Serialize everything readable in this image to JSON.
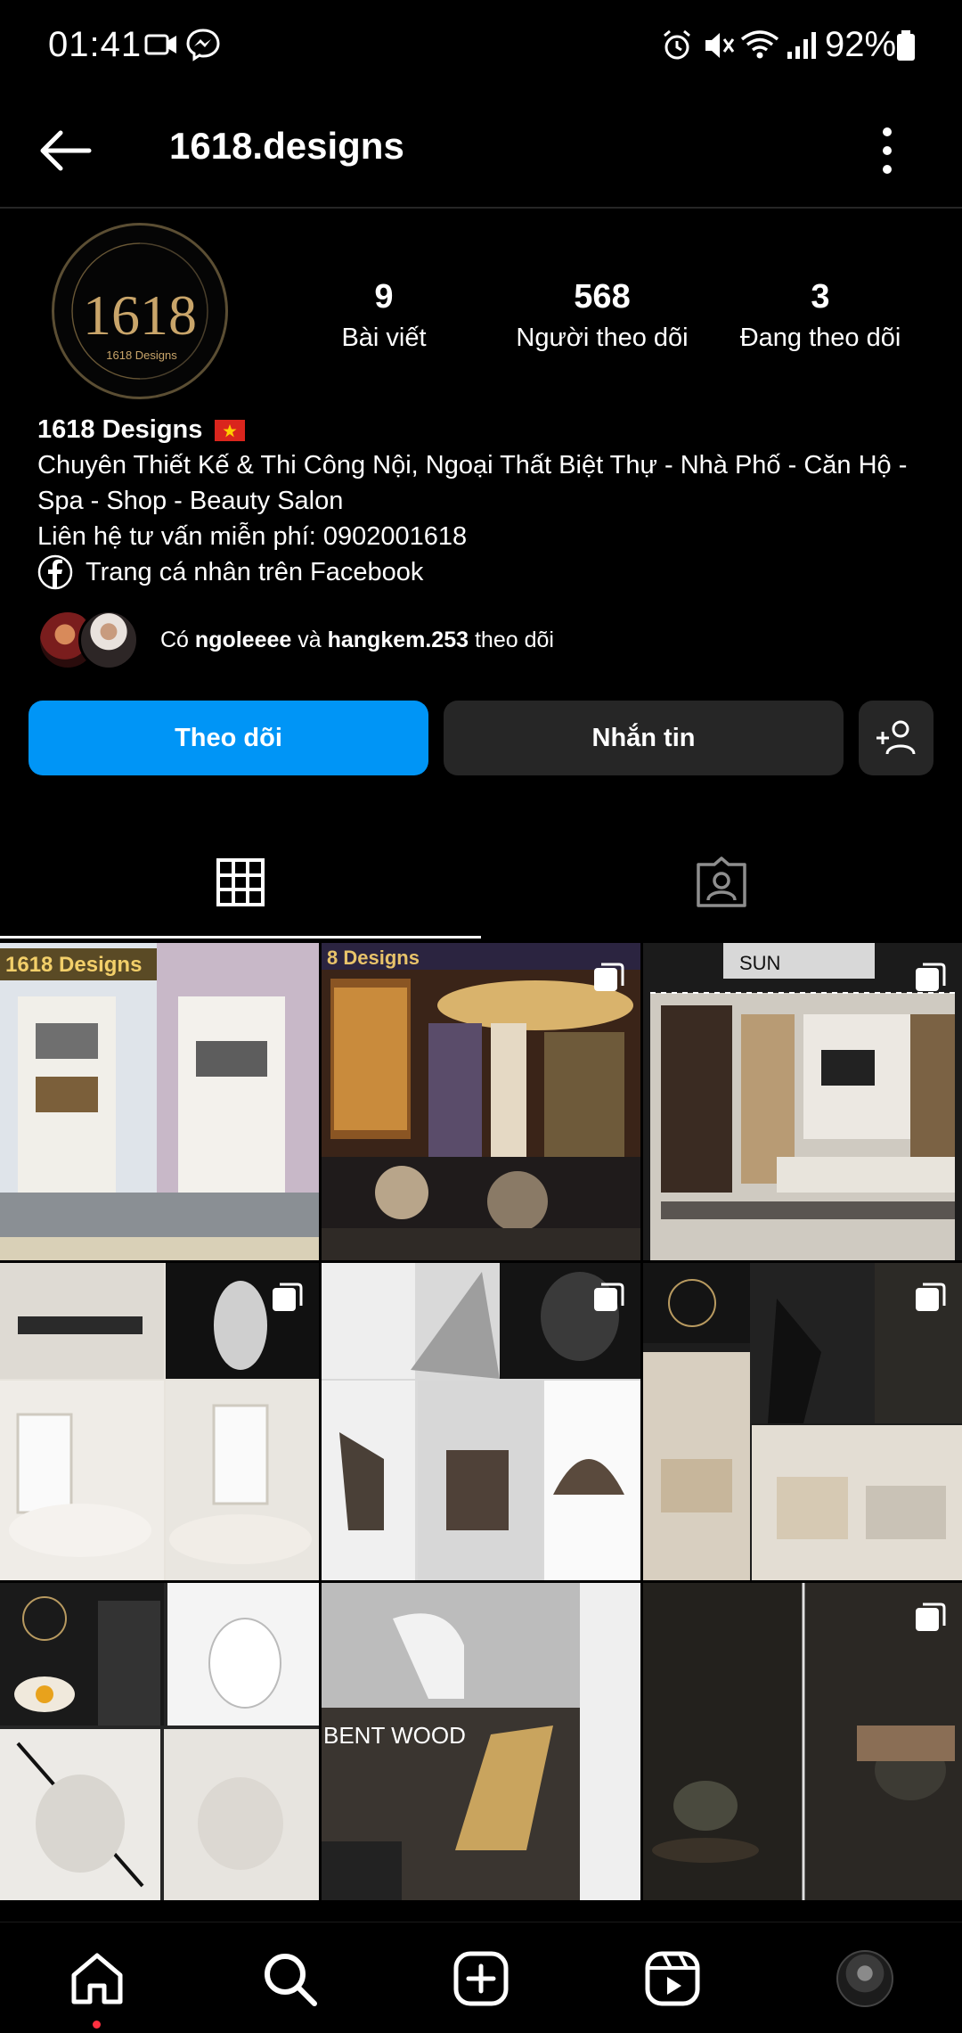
{
  "status_bar": {
    "time": "01:41",
    "battery": "92%",
    "icons": [
      "video-call-icon",
      "messenger-icon",
      "alarm-icon",
      "vibrate-icon",
      "wifi-icon",
      "signal-icon",
      "battery-icon"
    ]
  },
  "header": {
    "username": "1618.designs"
  },
  "profile": {
    "avatar_text_top": "1618",
    "avatar_text_bottom": "1618 Designs",
    "stats": [
      {
        "value": "9",
        "label": "Bài viết"
      },
      {
        "value": "568",
        "label": "Người theo dõi"
      },
      {
        "value": "3",
        "label": "Đang theo dõi"
      }
    ],
    "display_name": "1618 Designs",
    "bio_line1": "Chuyên Thiết Kế & Thi Công Nội, Ngoại Thất Biệt Thự - Nhà Phố - Căn Hộ - Spa - Shop - Beauty Salon",
    "bio_line2": "Liên hệ tư vấn miễn phí: 0902001618",
    "facebook_link": "Trang cá nhân trên Facebook",
    "followed_by_prefix": "Có",
    "followed_by_user1": "ngoleeee",
    "followed_by_and": "và",
    "followed_by_user2": "hangkem.253",
    "followed_by_suffix": "theo dõi"
  },
  "actions": {
    "follow": "Theo dõi",
    "message": "Nhắn tin"
  },
  "posts": [
    {
      "label": "1618 Designs"
    },
    {
      "label": "8 Designs"
    },
    {
      "label": "SUN"
    },
    {
      "label": ""
    },
    {
      "label": ""
    },
    {
      "label": ""
    },
    {
      "label": ""
    },
    {
      "label": "BENT WOOD"
    },
    {
      "label": ""
    }
  ],
  "colors": {
    "background": "#000000",
    "follow_button": "#0095f6",
    "secondary_button": "#262626",
    "notification_dot": "#ff3040"
  }
}
